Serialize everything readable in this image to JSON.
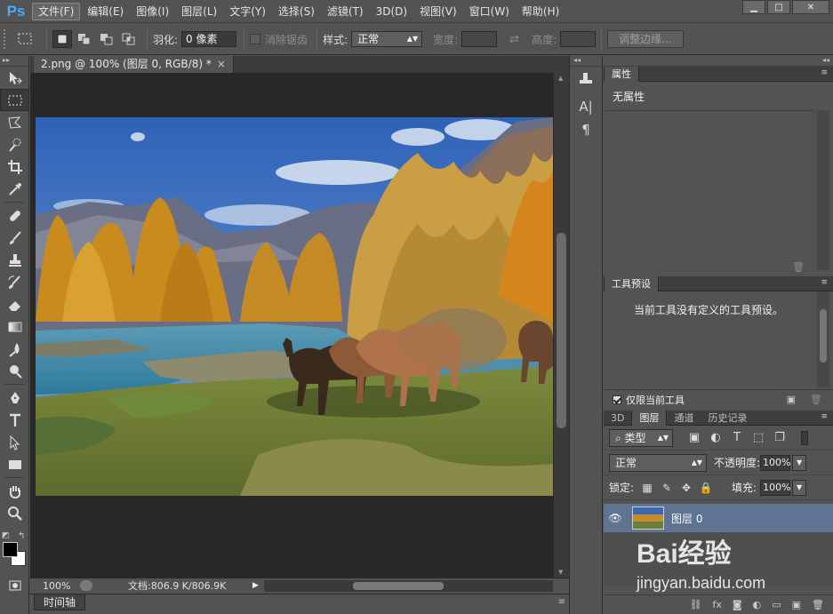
{
  "app": {
    "logo": "Ps"
  },
  "menu": [
    "文件(F)",
    "编辑(E)",
    "图像(I)",
    "图层(L)",
    "文字(Y)",
    "选择(S)",
    "滤镜(T)",
    "3D(D)",
    "视图(V)",
    "窗口(W)",
    "帮助(H)"
  ],
  "window_controls": {
    "minimize": "▁",
    "maximize": "□",
    "close": "✕"
  },
  "options": {
    "feather_label": "羽化:",
    "feather_value": "0 像素",
    "antialias_label": "消除锯齿",
    "style_label": "样式:",
    "style_value": "正常",
    "width_label": "宽度:",
    "height_label": "高度:",
    "refine_edge": "调整边缘..."
  },
  "document": {
    "tab_title": "2.png @ 100% (图层 0, RGB/8) *",
    "tab_close": "×"
  },
  "status": {
    "zoom": "100%",
    "doc_info": "文档:806.9 K/806.9K"
  },
  "timeline": {
    "label": "时间轴"
  },
  "panels": {
    "properties": {
      "tab": "属性",
      "empty": "无属性"
    },
    "tool_presets": {
      "tab": "工具预设",
      "message": "当前工具没有定义的工具预设。",
      "current_only": "仅限当前工具"
    },
    "layers": {
      "tabs": [
        "3D",
        "图层",
        "通道",
        "历史记录"
      ],
      "kind": "类型",
      "blend": "正常",
      "opacity_label": "不透明度:",
      "opacity_value": "100%",
      "lock_label": "锁定:",
      "fill_label": "填充:",
      "fill_value": "100%",
      "layer_name": "图层 0"
    }
  },
  "strip": {
    "char_icon": "A|",
    "para_icon": "¶"
  },
  "watermark": {
    "brand": "Bai经验",
    "url": "jingyan.baidu.com"
  },
  "colors": {
    "accent_blue": "#4aa8ff",
    "selected_layer": "#5e7492"
  }
}
